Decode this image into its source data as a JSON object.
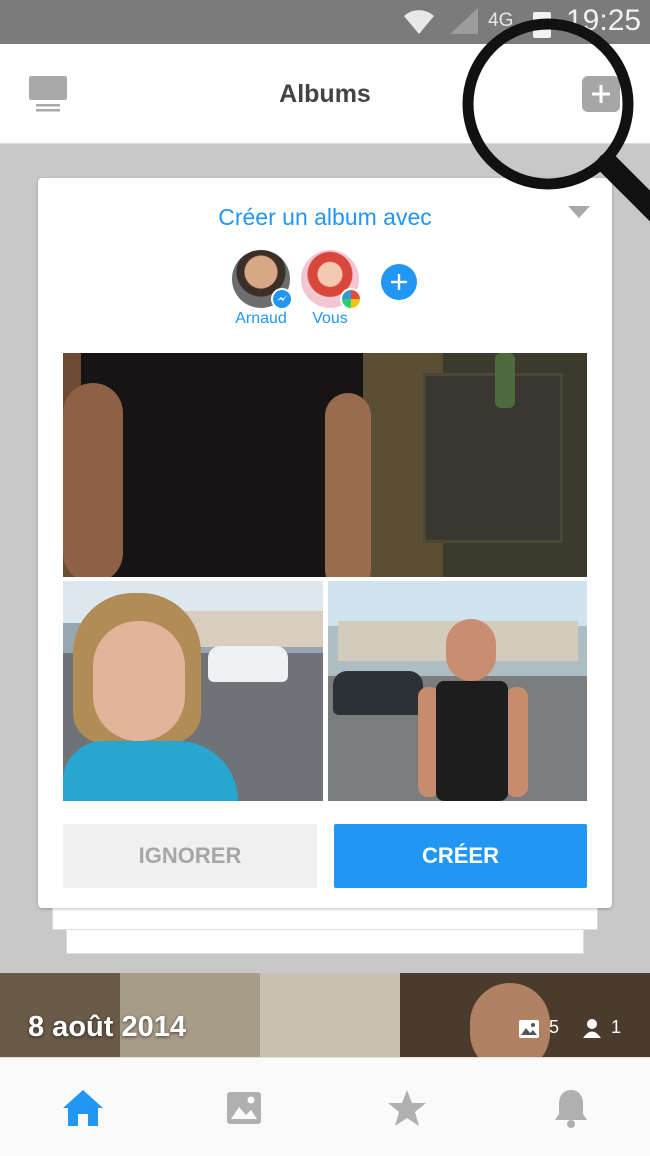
{
  "status_bar": {
    "network": "4G",
    "time": "19:25"
  },
  "header": {
    "title": "Albums"
  },
  "suggestion_card": {
    "title": "Créer un album avec",
    "people": [
      {
        "name": "Arnaud",
        "badge": "messenger-badge-icon"
      },
      {
        "name": "Vous",
        "badge": "photos-badge-icon"
      }
    ],
    "ignore_label": "IGNORER",
    "create_label": "CRÉER"
  },
  "album": {
    "date": "8 août 2014",
    "photo_count": "5",
    "people_count": "1"
  },
  "bottom_nav": [
    "home",
    "photos",
    "favorites",
    "notifications"
  ],
  "colors": {
    "accent": "#2196f3",
    "status_bar": "#7b7b7b",
    "background": "#c8c8c8"
  }
}
